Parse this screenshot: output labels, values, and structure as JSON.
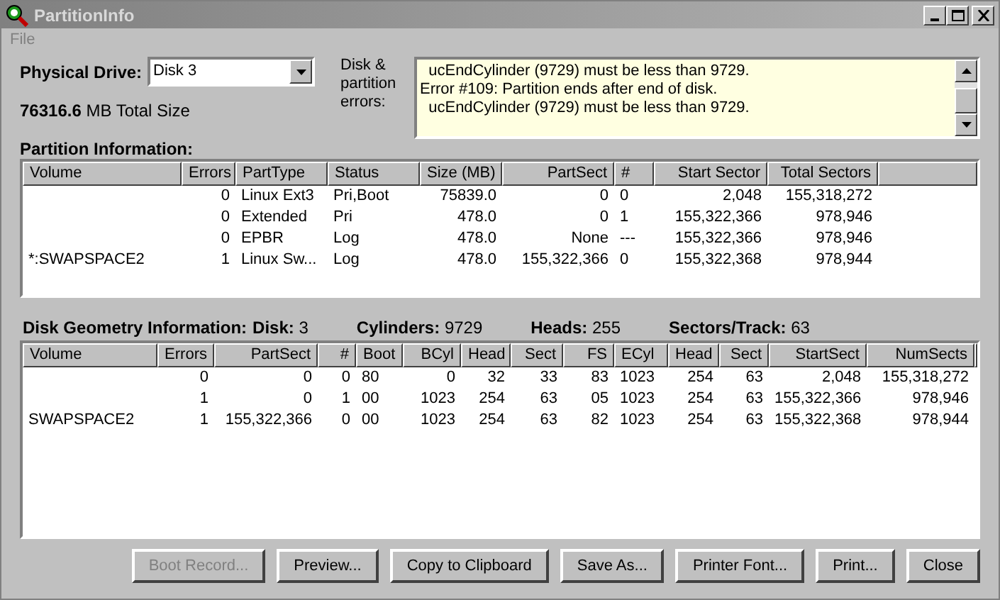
{
  "window": {
    "title": "PartitionInfo"
  },
  "menu": [
    {
      "label": "File",
      "disabled": true
    }
  ],
  "drive": {
    "label": "Physical Drive:",
    "value": "Disk 3"
  },
  "total_size": {
    "value": "76316.6",
    "unit": "MB Total Size"
  },
  "errors": {
    "label": "Disk & partition errors:",
    "lines": [
      "  ucEndCylinder (9729) must be less than 9729.",
      "Error #109: Partition ends after end of disk.",
      "  ucEndCylinder (9729) must be less than 9729."
    ]
  },
  "partition_info": {
    "title": "Partition Information:",
    "columns": [
      "Volume",
      "Errors",
      "PartType",
      "Status",
      "Size (MB)",
      "PartSect",
      "#",
      "Start Sector",
      "Total Sectors"
    ],
    "rows": [
      [
        "",
        "0",
        "Linux Ext3",
        "Pri,Boot",
        "75839.0",
        "0",
        "0",
        "2,048",
        "155,318,272"
      ],
      [
        "",
        "0",
        "Extended",
        "Pri",
        "478.0",
        "0",
        "1",
        "155,322,366",
        "978,946"
      ],
      [
        "",
        "0",
        "EPBR",
        "Log",
        "478.0",
        "None",
        "---",
        "155,322,366",
        "978,946"
      ],
      [
        "*:SWAPSPACE2",
        "1",
        "Linux Sw...",
        "Log",
        "478.0",
        "155,322,366",
        "0",
        "155,322,368",
        "978,944"
      ]
    ]
  },
  "geometry": {
    "title": "Disk Geometry Information:",
    "fields": [
      {
        "label": "Disk:",
        "value": "3"
      },
      {
        "label": "Cylinders:",
        "value": "9729"
      },
      {
        "label": "Heads:",
        "value": "255"
      },
      {
        "label": "Sectors/Track:",
        "value": "63"
      }
    ],
    "columns": [
      "Volume",
      "Errors",
      "PartSect",
      "#",
      "Boot",
      "BCyl",
      "Head",
      "Sect",
      "FS",
      "ECyl",
      "Head",
      "Sect",
      "StartSect",
      "NumSects"
    ],
    "rows": [
      [
        "",
        "0",
        "0",
        "0",
        "80",
        "0",
        "32",
        "33",
        "83",
        "1023",
        "254",
        "63",
        "2,048",
        "155,318,272"
      ],
      [
        "",
        "1",
        "0",
        "1",
        "00",
        "1023",
        "254",
        "63",
        "05",
        "1023",
        "254",
        "63",
        "155,322,366",
        "978,946"
      ],
      [
        "SWAPSPACE2",
        "1",
        "155,322,366",
        "0",
        "00",
        "1023",
        "254",
        "63",
        "82",
        "1023",
        "254",
        "63",
        "155,322,368",
        "978,944"
      ]
    ]
  },
  "buttons": [
    {
      "label": "Boot Record...",
      "disabled": true
    },
    {
      "label": "Preview...",
      "disabled": false
    },
    {
      "label": "Copy to Clipboard",
      "disabled": false
    },
    {
      "label": "Save As...",
      "disabled": false
    },
    {
      "label": "Printer Font...",
      "disabled": false
    },
    {
      "label": "Print...",
      "disabled": false
    },
    {
      "label": "Close",
      "disabled": false
    }
  ]
}
